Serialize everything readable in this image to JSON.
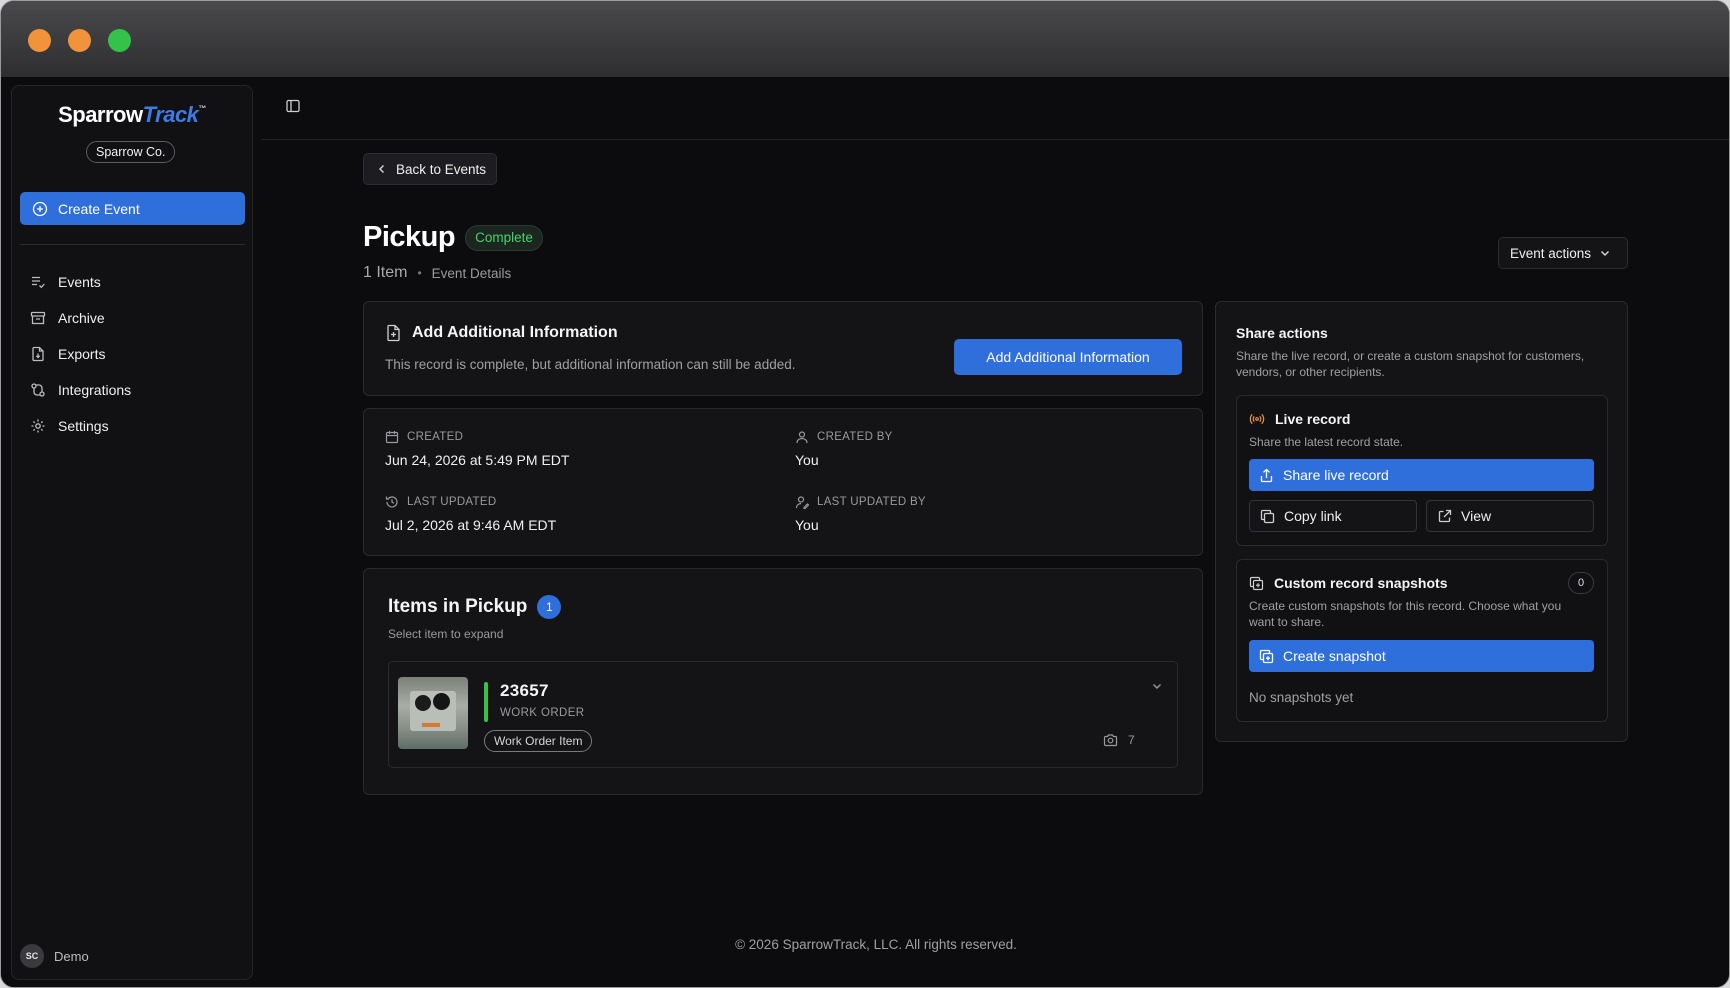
{
  "brand": {
    "name_part1": "Sparrow",
    "name_part2": "Track",
    "trademark": "™",
    "org": "Sparrow Co."
  },
  "sidebar": {
    "create_label": "Create Event",
    "items": [
      {
        "label": "Events",
        "icon": "list-check-icon"
      },
      {
        "label": "Archive",
        "icon": "archive-box-icon"
      },
      {
        "label": "Exports",
        "icon": "file-export-icon"
      },
      {
        "label": "Integrations",
        "icon": "integrations-icon"
      },
      {
        "label": "Settings",
        "icon": "gear-icon"
      }
    ],
    "user": {
      "initials": "SC",
      "name": "Demo"
    }
  },
  "header": {
    "back_label": "Back to Events"
  },
  "page": {
    "title": "Pickup",
    "status": "Complete",
    "item_count": "1 Item",
    "separator": "•",
    "details_label": "Event Details",
    "actions_label": "Event actions"
  },
  "additional_info": {
    "title": "Add Additional Information",
    "description": "This record is complete, but additional information can still be added.",
    "button_label": "Add Additional Information"
  },
  "meta": {
    "created_label": "CREATED",
    "created_value": "Jun 24, 2026 at 5:49 PM EDT",
    "created_by_label": "CREATED BY",
    "created_by_value": "You",
    "updated_label": "LAST UPDATED",
    "updated_value": "Jul 2, 2026 at 9:46 AM EDT",
    "updated_by_label": "LAST UPDATED BY",
    "updated_by_value": "You"
  },
  "items": {
    "title": "Items in Pickup",
    "count": "1",
    "subtitle": "Select item to expand",
    "rows": [
      {
        "id": "23657",
        "type": "WORK ORDER",
        "tag": "Work Order Item",
        "photos": "7",
        "status_color": "#35c24a"
      }
    ]
  },
  "share": {
    "title": "Share actions",
    "description": "Share the live record, or create a custom snapshot for customers, vendors, or other recipients.",
    "live": {
      "title": "Live record",
      "description": "Share the latest record state.",
      "share_label": "Share live record",
      "copy_label": "Copy link",
      "view_label": "View"
    },
    "snapshots": {
      "title": "Custom record snapshots",
      "count": "0",
      "description": "Create custom snapshots for this record. Choose what you want to share.",
      "create_label": "Create snapshot",
      "empty_label": "No snapshots yet"
    }
  },
  "footer": {
    "copyright": "© 2026 SparrowTrack, LLC. All rights reserved."
  },
  "colors": {
    "accent": "#2f6fdc",
    "success": "#47d36a",
    "live_icon": "#f0933b"
  }
}
